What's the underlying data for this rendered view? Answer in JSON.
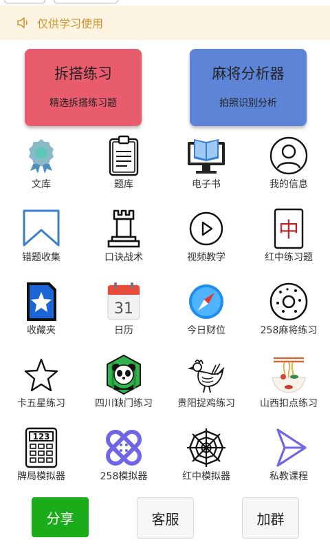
{
  "notice": {
    "text": "仅供学习使用"
  },
  "cards": [
    {
      "title": "拆搭练习",
      "subtitle": "精选拆搭练习题",
      "color": "#e85c6d"
    },
    {
      "title": "麻将分析器",
      "subtitle": "拍照识别分析",
      "color": "#5e84d8"
    }
  ],
  "grid": [
    {
      "label": "文库",
      "icon": "award-ribbon-icon"
    },
    {
      "label": "题库",
      "icon": "clipboard-icon"
    },
    {
      "label": "电子书",
      "icon": "ebook-monitor-icon"
    },
    {
      "label": "我的信息",
      "icon": "user-profile-icon"
    },
    {
      "label": "错题收集",
      "icon": "bookmark-icon"
    },
    {
      "label": "口诀战术",
      "icon": "chess-rook-icon"
    },
    {
      "label": "视频教学",
      "icon": "play-icon"
    },
    {
      "label": "红中练习题",
      "icon": "red-dragon-tile-icon"
    },
    {
      "label": "收藏夹",
      "icon": "favorites-star-icon"
    },
    {
      "label": "日历",
      "icon": "calendar-icon"
    },
    {
      "label": "今日财位",
      "icon": "compass-icon"
    },
    {
      "label": "258麻将练习",
      "icon": "donut-icon"
    },
    {
      "label": "卡五星练习",
      "icon": "star-outline-icon"
    },
    {
      "label": "四川缺门练习",
      "icon": "panda-icon"
    },
    {
      "label": "贵阳捉鸡练习",
      "icon": "chicken-icon"
    },
    {
      "label": "山西扣点练习",
      "icon": "noodle-bowl-icon"
    },
    {
      "label": "牌局模拟器",
      "icon": "calculator-icon"
    },
    {
      "label": "258模拟器",
      "icon": "bandage-icon"
    },
    {
      "label": "红中模拟器",
      "icon": "spider-web-icon"
    },
    {
      "label": "私教课程",
      "icon": "play-triangle-icon"
    }
  ],
  "buttons": {
    "share": "分享",
    "service": "客服",
    "join_group": "加群"
  },
  "calendar_day": "31",
  "calculator_digits": "123",
  "red_tile_char": "中",
  "colors": {
    "notice_bg": "#fdf4e2",
    "notice_text": "#d4932e",
    "share_green": "#1aad19"
  }
}
